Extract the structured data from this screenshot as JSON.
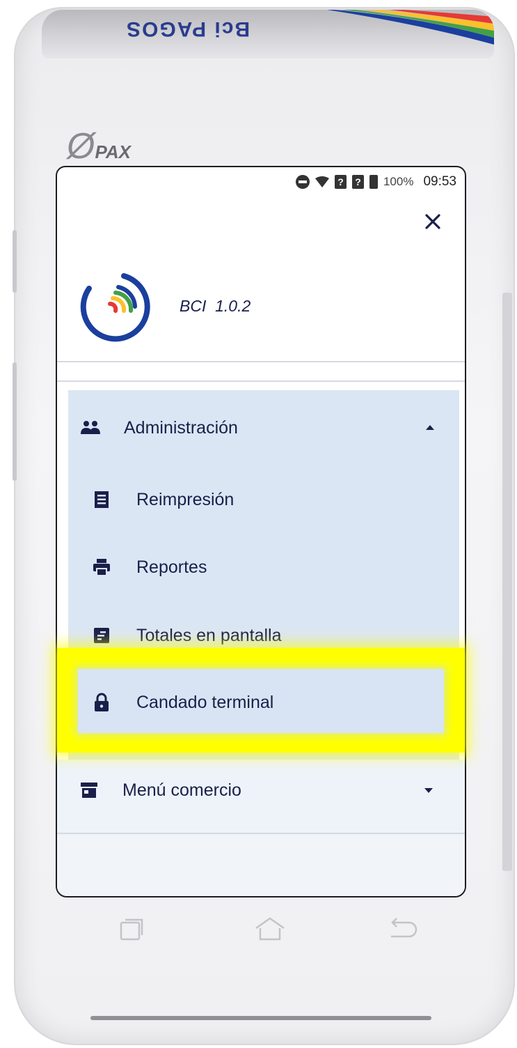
{
  "device": {
    "brand_top": "Bci PAGOS",
    "maker_logo": "PAX",
    "nav_buttons": [
      "recent-apps-icon",
      "home-icon",
      "back-icon"
    ]
  },
  "status_bar": {
    "battery": "100%",
    "time": "09:53",
    "icons": [
      "do-not-disturb-icon",
      "wifi-icon",
      "no-sim-icon",
      "no-sim-icon",
      "battery-icon"
    ]
  },
  "header": {
    "close_icon": "close-icon",
    "app_version": "BCI  1.0.2"
  },
  "menu": {
    "administracion": {
      "label": "Administración",
      "icon": "people-icon",
      "expanded": true,
      "items": [
        {
          "label": "Reimpresión",
          "icon": "receipt-icon"
        },
        {
          "label": "Reportes",
          "icon": "printer-icon"
        },
        {
          "label": "Totales en pantalla",
          "icon": "summary-icon"
        },
        {
          "label": "Candado terminal",
          "icon": "lock-icon"
        }
      ]
    },
    "comercio": {
      "label": "Menú comercio",
      "icon": "store-icon",
      "expanded": false
    }
  },
  "colors": {
    "accent_navy": "#1a1f4a",
    "menu_bg": "#dbe6f4",
    "highlight": "#ffff00",
    "logo_blue": "#1b3f9e",
    "logo_red": "#e53935",
    "logo_yellow": "#fbc02d",
    "logo_green": "#43a047"
  }
}
